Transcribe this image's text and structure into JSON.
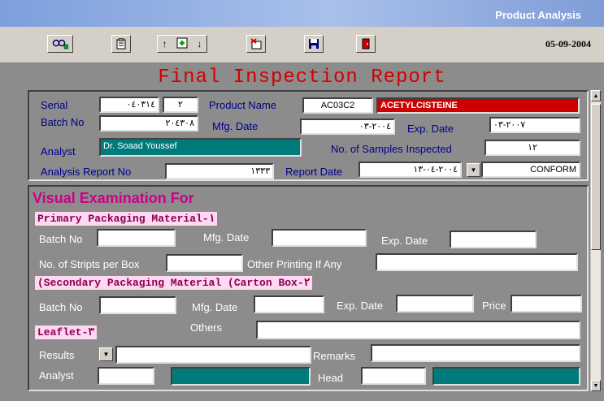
{
  "window": {
    "title": "Product Analysis"
  },
  "toolbar": {
    "date": "05-09-2004",
    "icons": [
      "binoculars-list-icon",
      "clipboard-icon",
      "move-up-icon",
      "add-record-icon",
      "move-down-icon",
      "delete-record-icon",
      "save-icon",
      "exit-door-icon"
    ]
  },
  "report": {
    "title": "Final Inspection Report",
    "serial_label": "Serial",
    "serial_a": "٠٤٠٣١٤",
    "serial_b": "٢",
    "product_name_label": "Product Name",
    "product_code": "AC03C2",
    "product_name": "ACETYLCISTEINE",
    "batch_no_label": "Batch No",
    "batch_no": "٢٠٤٣٠٨",
    "mfg_date_label": "Mfg. Date",
    "mfg_date": "٢٠٠٤-٠٣",
    "exp_date_label": "Exp. Date",
    "exp_date": "٢٠٠٧-٠٣",
    "analyst_label": "Analyst",
    "analyst": "Dr. Soaad Youssef",
    "samples_label": "No. of Samples Inspected",
    "samples": "١٢",
    "analysis_report_label": "Analysis Report No",
    "analysis_report_no": "١٣٣٣",
    "report_date_label": "Report Date",
    "report_date": "٢٠٠٤-٠٤-١٣",
    "conform": "CONFORM"
  },
  "visual": {
    "heading": "Visual Examination For",
    "primary_heading": "Primary Packaging Material-١",
    "primary": {
      "batch_no_label": "Batch No",
      "mfg_date_label": "Mfg. Date",
      "exp_date_label": "Exp. Date",
      "strips_label": "No. of Stripts per Box",
      "printing_label": "Other Printing If Any",
      "batch_no": "",
      "mfg_date": "",
      "exp_date": "",
      "strips": "",
      "printing": ""
    },
    "secondary_heading": "(Secondary Packaging Material (Carton Box-٢",
    "secondary": {
      "batch_no_label": "Batch No",
      "mfg_date_label": "Mfg. Date",
      "exp_date_label": "Exp. Date",
      "price_label": "Price",
      "batch_no": "",
      "mfg_date": "",
      "exp_date": "",
      "price": ""
    },
    "leaflet_heading": "Leaflet-٣",
    "others_label": "Others",
    "others": "",
    "results_label": "Results",
    "results": "",
    "remarks_label": "Remarks",
    "remarks": "",
    "analyst_label": "Analyst",
    "analyst": "",
    "head_label": "Head",
    "head": ""
  },
  "colors": {
    "teal": "#007b7b",
    "red": "#cc0000",
    "title_red": "#d40000",
    "pink_bg": "#ffd8f2"
  }
}
